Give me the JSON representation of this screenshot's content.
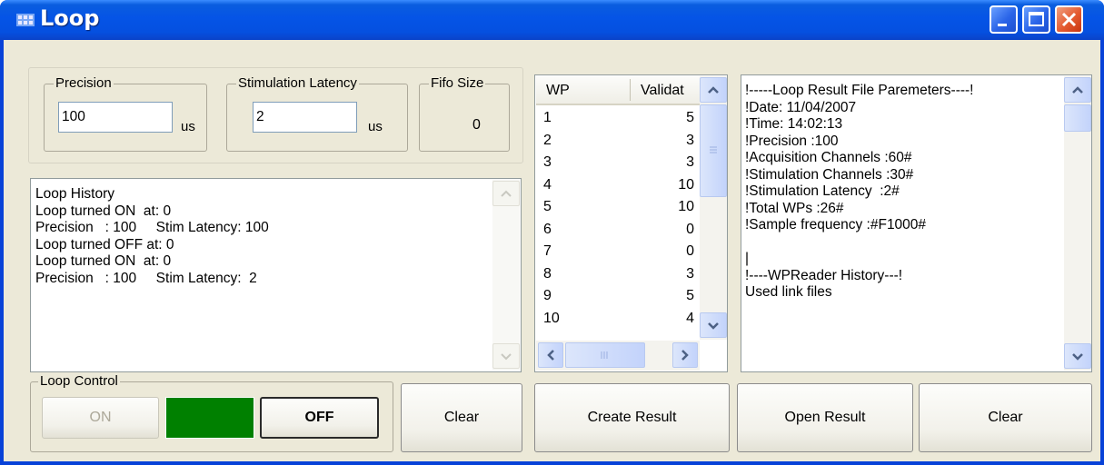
{
  "window": {
    "title": "Loop"
  },
  "settings": {
    "precision": {
      "legend": "Precision",
      "value": "100",
      "unit": "us"
    },
    "latency": {
      "legend": "Stimulation Latency",
      "value": "2",
      "unit": "us"
    },
    "fifo": {
      "legend": "Fifo Size",
      "value": "0"
    }
  },
  "history": {
    "lines": [
      "Loop History",
      "Loop turned ON  at: 0",
      "Precision   : 100     Stim Latency: 100",
      "Loop turned OFF at: 0",
      "Loop turned ON  at: 0",
      "Precision   : 100     Stim Latency:  2"
    ]
  },
  "wp_table": {
    "headers": [
      "WP",
      "Validat"
    ],
    "rows": [
      [
        "1",
        "5"
      ],
      [
        "2",
        "3"
      ],
      [
        "3",
        "3"
      ],
      [
        "4",
        "10"
      ],
      [
        "5",
        "10"
      ],
      [
        "6",
        "0"
      ],
      [
        "7",
        "0"
      ],
      [
        "8",
        "3"
      ],
      [
        "9",
        "5"
      ],
      [
        "10",
        "4"
      ]
    ]
  },
  "result_text": {
    "lines": [
      "!-----Loop Result File Paremeters----!",
      "!Date: 11/04/2007",
      "!Time: 14:02:13",
      "!Precision :100",
      "!Acquisition Channels :60#",
      "!Stimulation Channels :30#",
      "!Stimulation Latency  :2#",
      "!Total WPs :26#",
      "!Sample frequency :#F1000#",
      "",
      "|",
      "!----WPReader History---!",
      "Used link files"
    ]
  },
  "loop_control": {
    "legend": "Loop Control",
    "on_label": "ON",
    "off_label": "OFF",
    "indicator_color": "#008000"
  },
  "buttons": {
    "clear_history": "Clear",
    "create_result": "Create Result",
    "open_result": "Open Result",
    "clear_result": "Clear"
  }
}
